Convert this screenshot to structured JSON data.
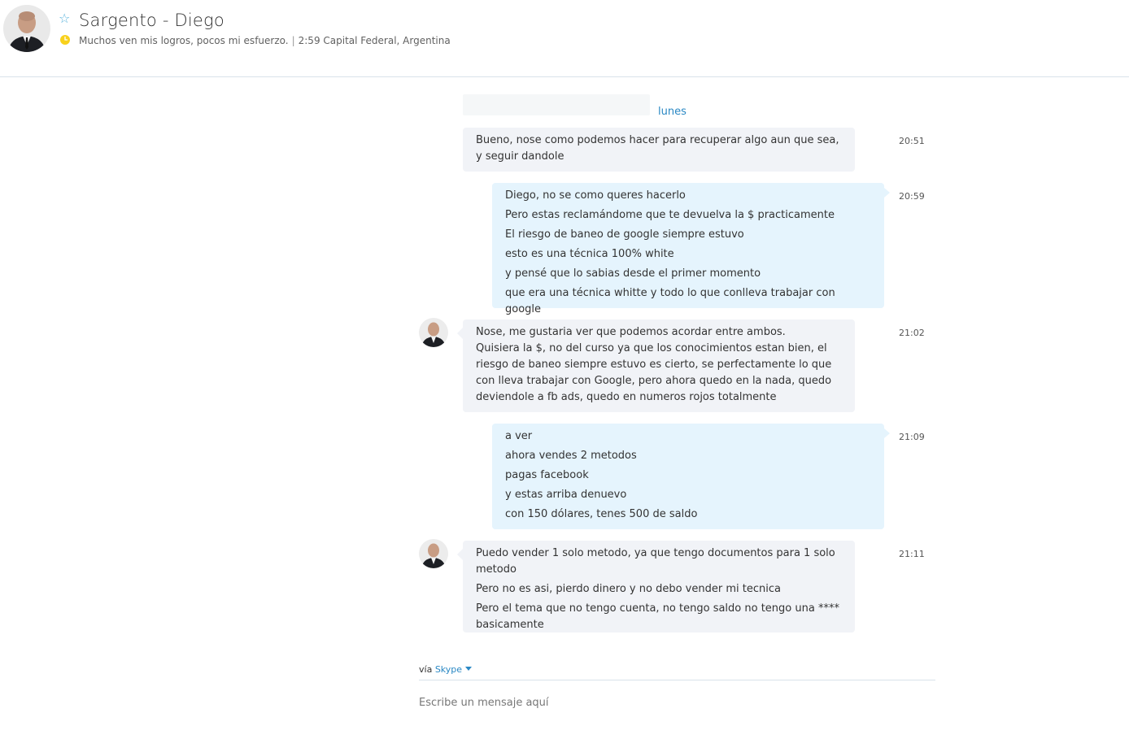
{
  "header": {
    "title": "Sargento - Diego",
    "mood": "Muchos ven mis logros, pocos mi esfuerzo.",
    "time_location": "2:59 Capital Federal, Argentina",
    "status": "away"
  },
  "chat": {
    "day_label": "lunes",
    "messages": [
      {
        "direction": "in",
        "time": "20:51",
        "avatar": false,
        "lines": [
          "Bueno, nose como podemos hacer para recuperar algo aun que sea, y seguir dandole"
        ]
      },
      {
        "direction": "out",
        "time": "20:59",
        "lines": [
          "Diego, no se como queres hacerlo",
          "Pero estas reclamándome que te devuelva la $ practicamente",
          "El riesgo de baneo de google siempre estuvo",
          "esto es una técnica 100% white",
          "y pensé que lo sabias desde el primer momento",
          "que era una técnica whitte y todo lo que conlleva trabajar con google"
        ]
      },
      {
        "direction": "in",
        "time": "21:02",
        "avatar": true,
        "lines": [
          "Nose, me gustaria ver que podemos acordar entre ambos.",
          "Quisiera la $, no del curso ya que los conocimientos estan bien, el riesgo de baneo siempre estuvo es cierto, se perfectamente lo que con lleva trabajar con Google, pero ahora quedo en la nada, quedo deviendole a fb ads, quedo en numeros rojos totalmente"
        ]
      },
      {
        "direction": "out",
        "time": "21:09",
        "lines": [
          "a ver",
          "ahora vendes 2 metodos",
          "pagas facebook",
          "y estas arriba denuevo",
          "con 150 dólares, tenes 500 de saldo"
        ]
      },
      {
        "direction": "in",
        "time": "21:11",
        "avatar": true,
        "lines": [
          "Puedo vender 1 solo metodo, ya que tengo documentos para 1 solo metodo",
          "Pero no es asi, pierdo dinero y no debo vender mi tecnica",
          "Pero el tema que no tengo cuenta, no tengo saldo no tengo una **** basicamente"
        ]
      }
    ]
  },
  "footer": {
    "via_prefix": "vía",
    "via_service": "Skype",
    "compose_placeholder": "Escribe un mensaje aquí"
  },
  "colors": {
    "accent": "#2a88c4",
    "incoming_bubble": "#f1f3f7",
    "outgoing_bubble": "#e5f4fd",
    "away_status": "#f8d11c",
    "star": "#59b3dc"
  },
  "icons": [
    "contact-avatar",
    "favorite-star-icon",
    "away-clock-icon",
    "dropdown-caret-icon"
  ]
}
